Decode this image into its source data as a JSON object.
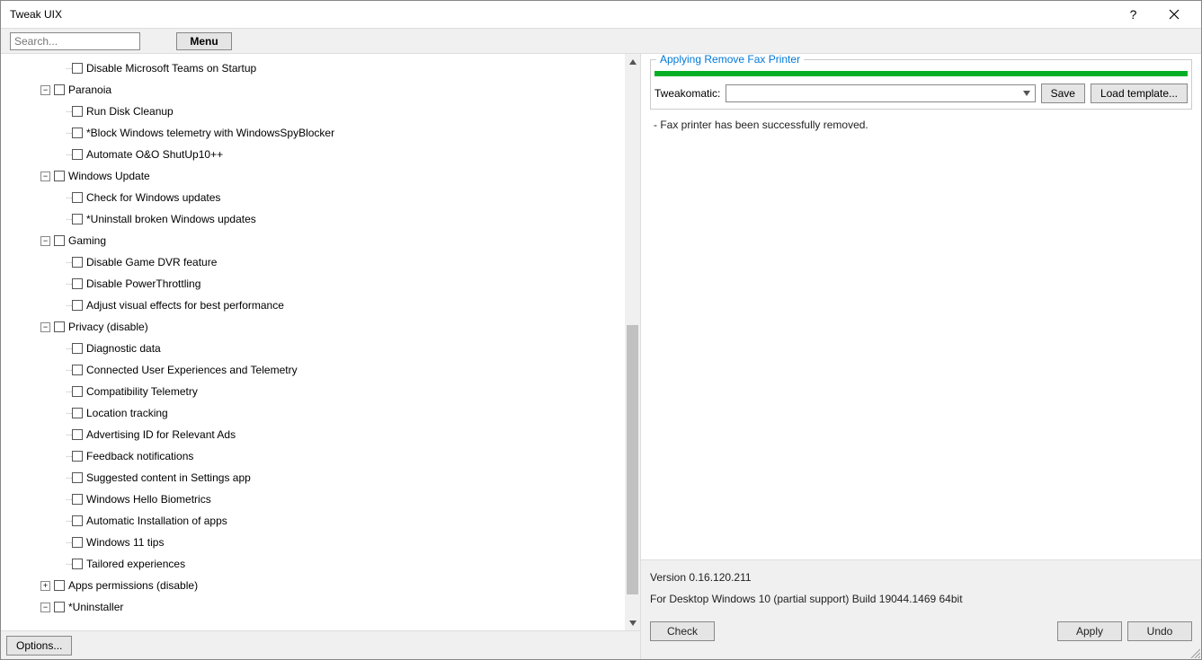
{
  "window": {
    "title": "Tweak UIX"
  },
  "toolbar": {
    "search_placeholder": "Search...",
    "menu_label": "Menu"
  },
  "tree": [
    {
      "level": 2,
      "type": "leaf",
      "label": "Disable Microsoft Teams on Startup"
    },
    {
      "level": 1,
      "type": "group",
      "expander": "−",
      "label": "Paranoia"
    },
    {
      "level": 2,
      "type": "leaf",
      "label": "Run Disk Cleanup"
    },
    {
      "level": 2,
      "type": "leaf",
      "label": "*Block Windows telemetry with WindowsSpyBlocker"
    },
    {
      "level": 2,
      "type": "leaf",
      "label": "Automate O&O ShutUp10++"
    },
    {
      "level": 1,
      "type": "group",
      "expander": "−",
      "label": "Windows Update"
    },
    {
      "level": 2,
      "type": "leaf",
      "label": "Check for Windows updates"
    },
    {
      "level": 2,
      "type": "leaf",
      "label": "*Uninstall broken Windows updates"
    },
    {
      "level": 1,
      "type": "group",
      "expander": "−",
      "label": "Gaming"
    },
    {
      "level": 2,
      "type": "leaf",
      "label": "Disable Game DVR feature"
    },
    {
      "level": 2,
      "type": "leaf",
      "label": "Disable PowerThrottling"
    },
    {
      "level": 2,
      "type": "leaf",
      "label": "Adjust visual effects for best performance"
    },
    {
      "level": 1,
      "type": "group",
      "expander": "−",
      "label": "Privacy (disable)"
    },
    {
      "level": 2,
      "type": "leaf",
      "label": "Diagnostic data"
    },
    {
      "level": 2,
      "type": "leaf",
      "label": "Connected User Experiences and Telemetry"
    },
    {
      "level": 2,
      "type": "leaf",
      "label": "Compatibility Telemetry"
    },
    {
      "level": 2,
      "type": "leaf",
      "label": "Location tracking"
    },
    {
      "level": 2,
      "type": "leaf",
      "label": "Advertising ID for Relevant Ads"
    },
    {
      "level": 2,
      "type": "leaf",
      "label": "Feedback notifications"
    },
    {
      "level": 2,
      "type": "leaf",
      "label": "Suggested content in Settings app"
    },
    {
      "level": 2,
      "type": "leaf",
      "label": "Windows Hello Biometrics"
    },
    {
      "level": 2,
      "type": "leaf",
      "label": "Automatic Installation of apps"
    },
    {
      "level": 2,
      "type": "leaf",
      "label": "Windows 11 tips"
    },
    {
      "level": 2,
      "type": "leaf",
      "label": "Tailored experiences"
    },
    {
      "level": 1,
      "type": "group",
      "expander": "+",
      "label": "Apps permissions (disable)"
    },
    {
      "level": 1,
      "type": "group-cut",
      "expander": "−",
      "label": "*Uninstaller"
    }
  ],
  "left_footer": {
    "options_label": "Options..."
  },
  "right": {
    "legend": "Applying Remove Fax Printer",
    "tweakomatic_label": "Tweakomatic:",
    "save_label": "Save",
    "load_label": "Load template...",
    "log_text": "- Fax printer has been successfully removed.",
    "version_line": "Version 0.16.120.211",
    "build_line": "For Desktop Windows 10 (partial support) Build 19044.1469 64bit",
    "check_label": "Check",
    "apply_label": "Apply",
    "undo_label": "Undo"
  }
}
